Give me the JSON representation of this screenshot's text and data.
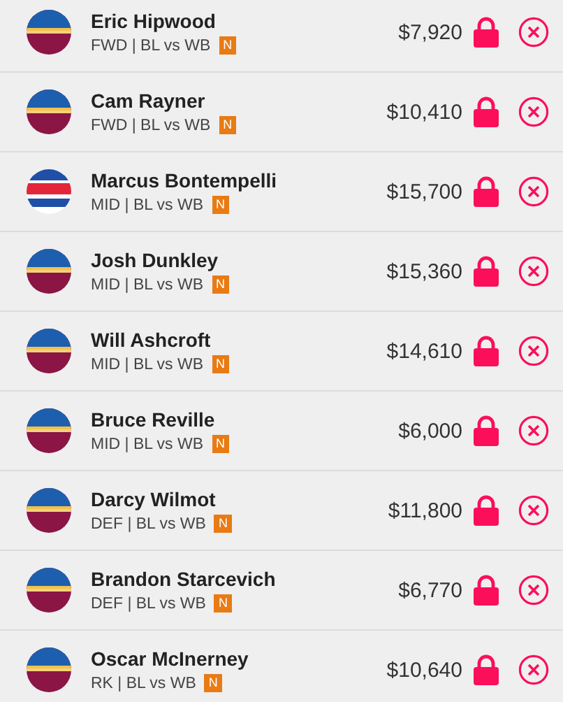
{
  "players": [
    {
      "name": "Eric Hipwood",
      "kind": "lions",
      "info": "FWD | BL vs WB",
      "badge": "N",
      "price": "$7,920"
    },
    {
      "name": "Cam Rayner",
      "kind": "lions",
      "info": "FWD | BL vs WB",
      "badge": "N",
      "price": "$10,410"
    },
    {
      "name": "Marcus Bontempelli",
      "kind": "bulldogs",
      "info": "MID | BL vs WB",
      "badge": "N",
      "price": "$15,700"
    },
    {
      "name": "Josh Dunkley",
      "kind": "lions",
      "info": "MID | BL vs WB",
      "badge": "N",
      "price": "$15,360"
    },
    {
      "name": "Will Ashcroft",
      "kind": "lions",
      "info": "MID | BL vs WB",
      "badge": "N",
      "price": "$14,610"
    },
    {
      "name": "Bruce Reville",
      "kind": "lions",
      "info": "MID | BL vs WB",
      "badge": "N",
      "price": "$6,000"
    },
    {
      "name": "Darcy Wilmot",
      "kind": "lions",
      "info": "DEF | BL vs WB",
      "badge": "N",
      "price": "$11,800"
    },
    {
      "name": "Brandon Starcevich",
      "kind": "lions",
      "info": "DEF | BL vs WB",
      "badge": "N",
      "price": "$6,770"
    },
    {
      "name": "Oscar McInerney",
      "kind": "lions",
      "info": "RK | BL vs WB",
      "badge": "N",
      "price": "$10,640"
    }
  ]
}
